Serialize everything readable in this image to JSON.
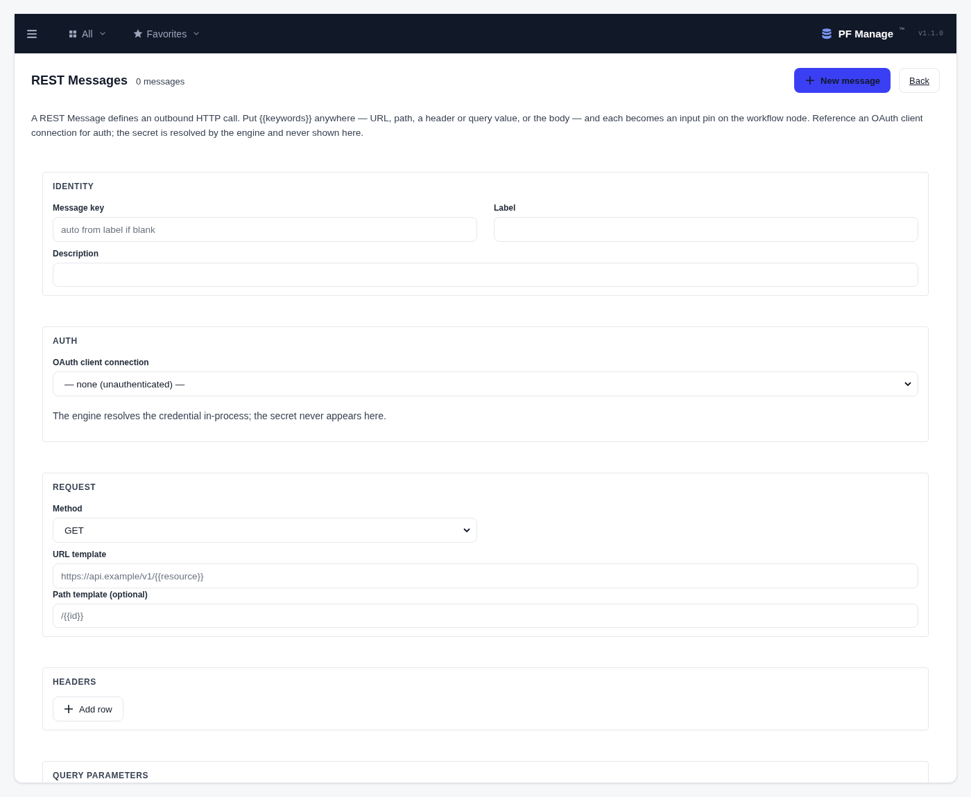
{
  "top_bar": {
    "apps_menu": {
      "label": "All"
    },
    "favorites_menu": {
      "label": "Favorites"
    },
    "brand": {
      "name": "PF Manage",
      "mark": "™",
      "version": "v1.1.0"
    }
  },
  "header": {
    "title": "REST Messages",
    "count": "0 messages",
    "new_button": "New message",
    "back_button": "Back"
  },
  "description": "A REST Message defines an outbound HTTP call. Put {{keywords}} anywhere — URL, path, a header or query value, or the body — and each becomes an input pin on the workflow node. Reference an OAuth client connection for auth; the secret is resolved by the engine and never shown here.",
  "identity": {
    "title": "IDENTITY",
    "message_key": {
      "label": "Message key",
      "placeholder": "auto from label if blank"
    },
    "label": {
      "label": "Label"
    },
    "description": {
      "label": "Description"
    }
  },
  "auth": {
    "title": "AUTH",
    "oauth_connection": {
      "label": "OAuth client connection",
      "value": "— none (unauthenticated) —"
    },
    "help": "The engine resolves the credential in-process; the secret never appears here."
  },
  "request": {
    "title": "REQUEST",
    "method": {
      "label": "Method",
      "value": "GET"
    },
    "url_template": {
      "label": "URL template",
      "placeholder": "https://api.example/v1/{{resource}}"
    },
    "path_template": {
      "label": "Path template (optional)",
      "placeholder": "/{{id}}"
    }
  },
  "headers": {
    "title": "HEADERS",
    "add_button": "Add row"
  },
  "query_parameters": {
    "title": "QUERY PARAMETERS"
  }
}
